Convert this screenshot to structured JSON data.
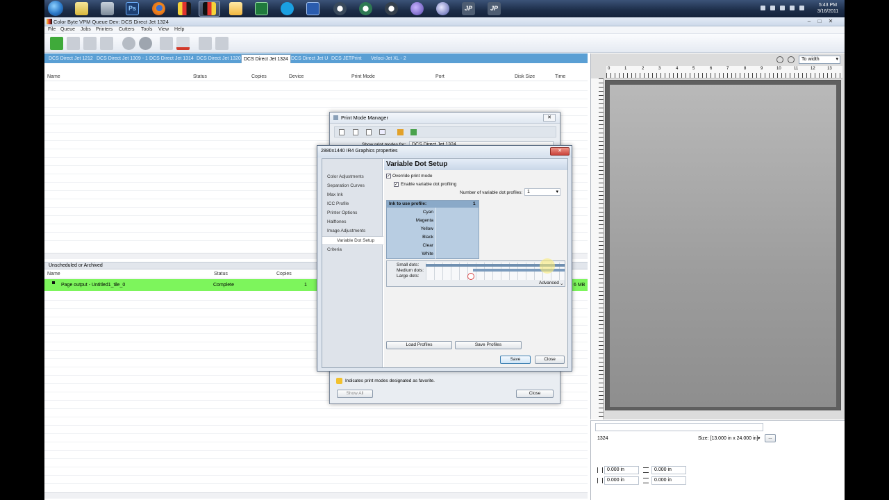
{
  "taskbar": {
    "clock_time": "5:43 PM",
    "clock_date": "3/16/2011",
    "icons": [
      "windows-orb-icon",
      "file-manager-icon",
      "generic-app-icon",
      "photoshop-icon",
      "firefox-icon",
      "app-icon",
      "app-icon-selected",
      "mail-icon",
      "excel-icon",
      "skype-icon",
      "word-icon",
      "app-icon",
      "app-icon",
      "app-icon",
      "globe-icon",
      "app-icon",
      "jp-icon",
      "jp-icon"
    ],
    "ps_label": "Ps",
    "jp_label": "JP"
  },
  "window": {
    "title": "Color Byte VPM Queue Dev: DCS Direct Jet 1324",
    "menus": [
      "File",
      "Queue",
      "Jobs",
      "Printers",
      "Cutters",
      "Tools",
      "View",
      "Help"
    ]
  },
  "tabs": [
    "DCS Direct Jet 1212",
    "DCS Direct Jet 1309 - 1",
    "DCS Direct Jet 1314",
    "DCS Direct Jet 1320",
    "DCS Direct Jet 1324",
    "DCS Direct Jet U",
    "DCS JETPrint",
    "Veloci-Jet XL - 2"
  ],
  "active_tab": 4,
  "queue": {
    "columns": [
      "Name",
      "Status",
      "Copies",
      "Device",
      "Print Mode",
      "Port",
      "Disk Size",
      "Time"
    ]
  },
  "archive": {
    "header": "Unscheduled or Archived",
    "columns": [
      "Name",
      "Status",
      "Copies"
    ],
    "row": {
      "name": "Page output - Untitled1_tile_0",
      "status": "Complete",
      "copies": "1",
      "size": "6 MB"
    }
  },
  "preview": {
    "zoom": "To width",
    "ruler_labels": [
      "0",
      "1",
      "2",
      "3",
      "4",
      "5",
      "6",
      "7",
      "8",
      "9",
      "10",
      "11",
      "12",
      "13"
    ]
  },
  "props": {
    "name": "1324",
    "size_label": "Size: [13.000 in x 24.000 in]",
    "more_button": "...",
    "offset_values": [
      "0.000 in",
      "0.000 in",
      "0.000 in",
      "0.000 in"
    ]
  },
  "print_mode_manager": {
    "title": "Print Mode Manager",
    "show_label": "Show print modes for:",
    "show_value": "DCS Direct Jet 1324",
    "favorite_note": "Indicates print modes designated as favorite.",
    "show_all": "Show All",
    "close": "Close"
  },
  "properties_dialog": {
    "title": "2880x1440 IR4 Graphics properties",
    "nav": [
      "Color Adjustments",
      "Separation Curves",
      "Max Ink",
      "ICC Profile",
      "Printer Options",
      "Halftones",
      "Image Adjustments",
      "Variable Dot Setup",
      "Criteria"
    ],
    "nav_selected": 7,
    "heading": "Variable Dot Setup",
    "override_label": "Override print mode",
    "override_checked": true,
    "enable_label": "Enable variable dot profiling",
    "enable_checked": true,
    "num_profiles_label": "Number of variable dot profiles:",
    "num_profiles_value": "1",
    "ink_header": "Ink to use profile:",
    "ink_header_col": "1",
    "inks": [
      "Cyan",
      "Magenta",
      "Yellow",
      "Black",
      "Clear",
      "White"
    ],
    "dot_labels": [
      "Small dots:",
      "Medium dots:",
      "Large dots:"
    ],
    "advanced_label": "Advanced",
    "load_profiles": "Load Profiles",
    "save_profiles": "Save Profiles",
    "save": "Save",
    "close": "Close"
  },
  "colors": {
    "tab_bar": "#5a9fd4",
    "selected_row": "#7df55c",
    "accent": "#3c7fb1"
  }
}
